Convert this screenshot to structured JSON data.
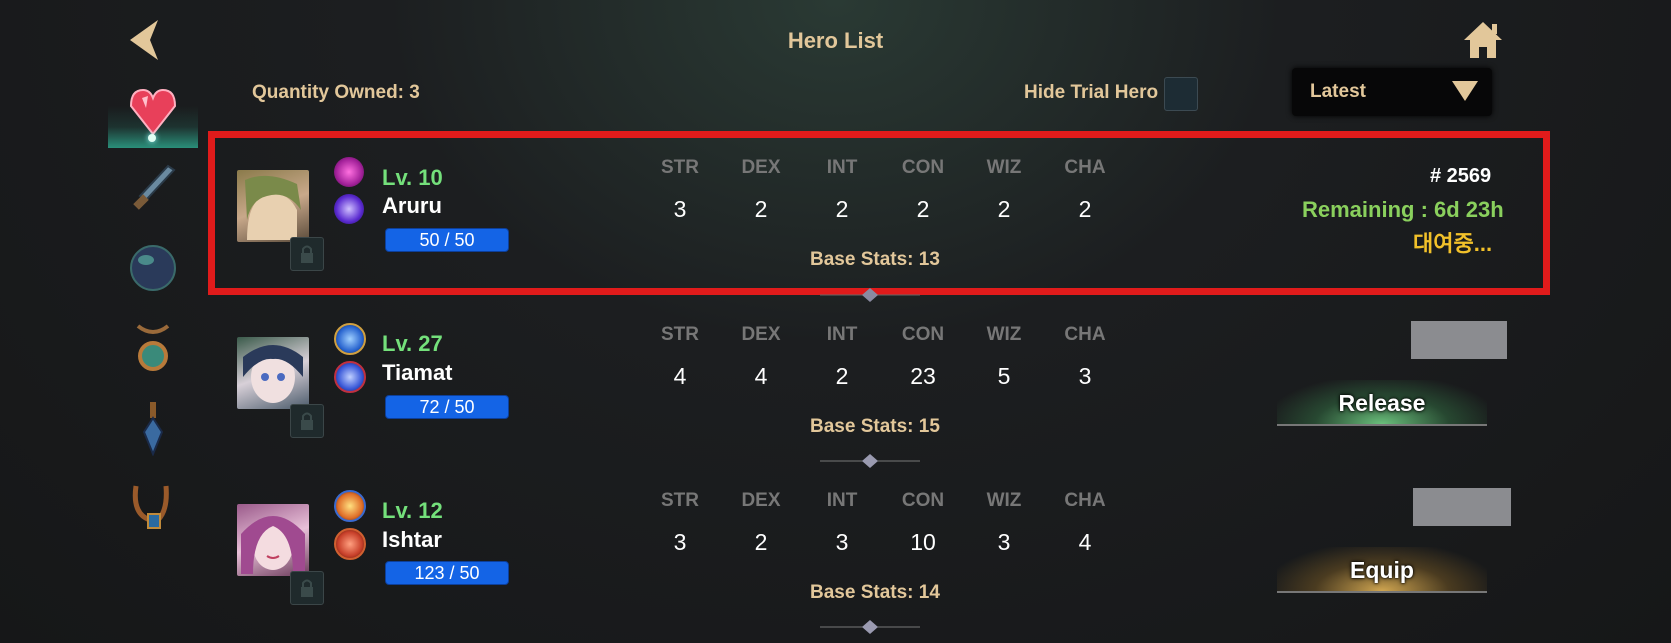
{
  "header": {
    "title": "Hero List",
    "quantity_label": "Quantity Owned: 3",
    "hide_trial_label": "Hide Trial Hero",
    "sort_value": "Latest"
  },
  "sidebar": {
    "items": [
      {
        "name": "heart-gem-icon",
        "active": true
      },
      {
        "name": "sword-icon",
        "active": false
      },
      {
        "name": "orb-icon",
        "active": false
      },
      {
        "name": "amulet-icon",
        "active": false
      },
      {
        "name": "earring-icon",
        "active": false
      },
      {
        "name": "necklace-icon",
        "active": false
      }
    ]
  },
  "stat_headers": [
    "STR",
    "DEX",
    "INT",
    "CON",
    "WIZ",
    "CHA"
  ],
  "heroes": [
    {
      "level": "Lv. 10",
      "name": "Aruru",
      "hp": "50 / 50",
      "stats": [
        "3",
        "2",
        "2",
        "2",
        "2",
        "2"
      ],
      "base_stats": "Base Stats: 13",
      "hero_id": "# 2569",
      "remaining": "Remaining : 6d 23h",
      "status": "대여중...",
      "elements": [
        "#a3219a",
        "#5a2ad0"
      ]
    },
    {
      "level": "Lv. 27",
      "name": "Tiamat",
      "hp": "72 / 50",
      "stats": [
        "4",
        "4",
        "2",
        "23",
        "5",
        "3"
      ],
      "base_stats": "Base Stats: 15",
      "action": "Release",
      "elements": [
        "#2a66d0",
        "#3a58d8"
      ]
    },
    {
      "level": "Lv. 12",
      "name": "Ishtar",
      "hp": "123 / 50",
      "stats": [
        "3",
        "2",
        "3",
        "10",
        "3",
        "4"
      ],
      "base_stats": "Base Stats: 14",
      "action": "Equip",
      "elements": [
        "#e0702a",
        "#c8402a"
      ]
    }
  ]
}
